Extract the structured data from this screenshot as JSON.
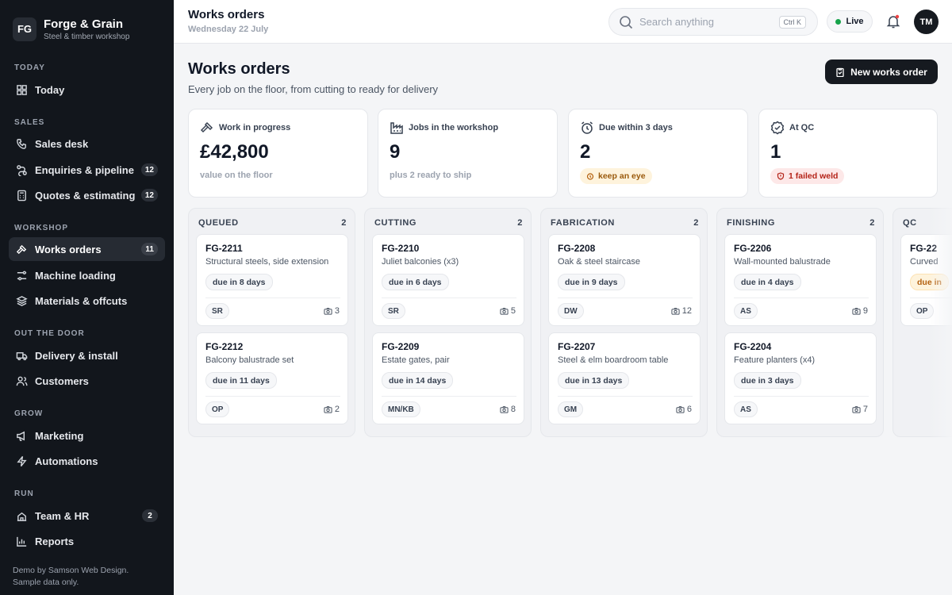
{
  "brand": {
    "logo": "FG",
    "name": "Forge & Grain",
    "tagline": "Steel & timber workshop"
  },
  "sidebar": {
    "sections": [
      {
        "label": "TODAY",
        "items": [
          {
            "label": "Today",
            "icon": "grid-icon",
            "badge": null
          }
        ]
      },
      {
        "label": "SALES",
        "items": [
          {
            "label": "Sales desk",
            "icon": "phone-icon",
            "badge": null
          },
          {
            "label": "Enquiries & pipeline",
            "icon": "pipeline-icon",
            "badge": "12"
          },
          {
            "label": "Quotes & estimating",
            "icon": "calculator-icon",
            "badge": "12"
          }
        ]
      },
      {
        "label": "WORKSHOP",
        "items": [
          {
            "label": "Works orders",
            "icon": "hammer-icon",
            "badge": "11",
            "active": true
          },
          {
            "label": "Machine loading",
            "icon": "sliders-icon",
            "badge": null
          },
          {
            "label": "Materials & offcuts",
            "icon": "layers-icon",
            "badge": null
          }
        ]
      },
      {
        "label": "OUT THE DOOR",
        "items": [
          {
            "label": "Delivery & install",
            "icon": "truck-icon",
            "badge": null
          },
          {
            "label": "Customers",
            "icon": "users-icon",
            "badge": null
          }
        ]
      },
      {
        "label": "GROW",
        "items": [
          {
            "label": "Marketing",
            "icon": "megaphone-icon",
            "badge": null
          },
          {
            "label": "Automations",
            "icon": "bolt-icon",
            "badge": null
          }
        ]
      },
      {
        "label": "RUN",
        "items": [
          {
            "label": "Team & HR",
            "icon": "team-icon",
            "badge": "2"
          },
          {
            "label": "Reports",
            "icon": "chart-icon",
            "badge": null
          }
        ]
      }
    ],
    "footer_line1": "Demo by Samson Web Design.",
    "footer_line2": "Sample data only."
  },
  "topbar": {
    "title": "Works orders",
    "date": "Wednesday 22 July",
    "search_placeholder": "Search anything",
    "shortcut": "Ctrl K",
    "live_label": "Live",
    "avatar": "TM"
  },
  "header": {
    "title": "Works orders",
    "subtitle": "Every job on the floor, from cutting to ready for delivery",
    "new_button": "New works order"
  },
  "stats": [
    {
      "label": "Work in progress",
      "icon": "hammer-icon",
      "value": "£42,800",
      "note": "value on the floor"
    },
    {
      "label": "Jobs in the workshop",
      "icon": "factory-icon",
      "value": "9",
      "note": "plus 2 ready to ship"
    },
    {
      "label": "Due within 3 days",
      "icon": "alarm-icon",
      "value": "2",
      "pill": "keep an eye",
      "pill_type": "warn"
    },
    {
      "label": "At QC",
      "icon": "check-badge-icon",
      "value": "1",
      "pill": "1 failed weld",
      "pill_type": "fail"
    }
  ],
  "board": {
    "columns": [
      {
        "name": "QUEUED",
        "count": "2",
        "cards": [
          {
            "id": "FG-2211",
            "title": "Structural steels, side extension",
            "due": "due in 8 days",
            "initials": "SR",
            "photos": "3"
          },
          {
            "id": "FG-2212",
            "title": "Balcony balustrade set",
            "due": "due in 11 days",
            "initials": "OP",
            "photos": "2"
          }
        ]
      },
      {
        "name": "CUTTING",
        "count": "2",
        "cards": [
          {
            "id": "FG-2210",
            "title": "Juliet balconies (x3)",
            "due": "due in 6 days",
            "initials": "SR",
            "photos": "5"
          },
          {
            "id": "FG-2209",
            "title": "Estate gates, pair",
            "due": "due in 14 days",
            "initials": "MN/KB",
            "photos": "8"
          }
        ]
      },
      {
        "name": "FABRICATION",
        "count": "2",
        "cards": [
          {
            "id": "FG-2208",
            "title": "Oak & steel staircase",
            "due": "due in 9 days",
            "initials": "DW",
            "photos": "12"
          },
          {
            "id": "FG-2207",
            "title": "Steel & elm boardroom table",
            "due": "due in 13 days",
            "initials": "GM",
            "photos": "6"
          }
        ]
      },
      {
        "name": "FINISHING",
        "count": "2",
        "cards": [
          {
            "id": "FG-2206",
            "title": "Wall-mounted balustrade",
            "due": "due in 4 days",
            "initials": "AS",
            "photos": "9"
          },
          {
            "id": "FG-2204",
            "title": "Feature planters (x4)",
            "due": "due in 3 days",
            "initials": "AS",
            "photos": "7"
          }
        ]
      },
      {
        "name": "QC",
        "count": "",
        "cards": [
          {
            "id": "FG-22",
            "title": "Curved",
            "due": "due in",
            "due_type": "warn",
            "initials": "OP",
            "photos": ""
          }
        ]
      }
    ]
  }
}
